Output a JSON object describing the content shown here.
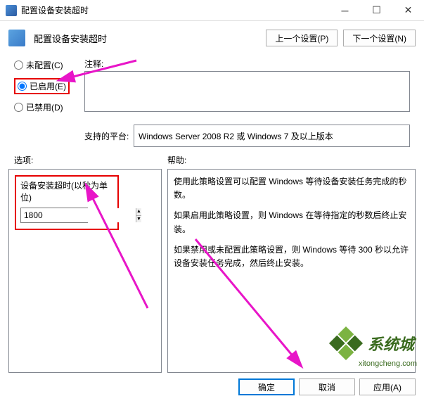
{
  "window": {
    "title": "配置设备安装超时"
  },
  "toolbar": {
    "title": "配置设备安装超时",
    "prev": "上一个设置(P)",
    "next": "下一个设置(N)"
  },
  "radios": {
    "not_configured": "未配置(C)",
    "enabled": "已启用(E)",
    "disabled": "已禁用(D)"
  },
  "comment": {
    "label": "注释:"
  },
  "platform": {
    "label": "支持的平台:",
    "value": "Windows Server 2008 R2 或 Windows 7 及以上版本"
  },
  "labels": {
    "options": "选项:",
    "help": "帮助:"
  },
  "timeout": {
    "label": "设备安装超时(以秒为单位)",
    "value": "1800"
  },
  "help": {
    "p1": "使用此策略设置可以配置 Windows 等待设备安装任务完成的秒数。",
    "p2": "如果启用此策略设置，则 Windows 在等待指定的秒数后终止安装。",
    "p3": "如果禁用或未配置此策略设置，则 Windows 等待 300 秒以允许设备安装任务完成，然后终止安装。"
  },
  "footer": {
    "ok": "确定",
    "cancel": "取消",
    "apply": "应用(A)"
  },
  "watermark": {
    "text": "系统城",
    "url": "xitongcheng.com"
  }
}
